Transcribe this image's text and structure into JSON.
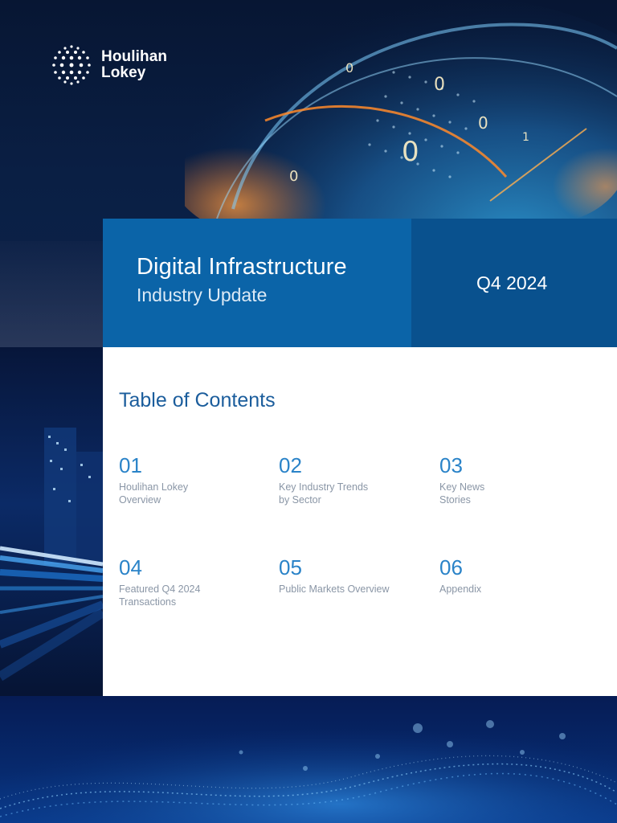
{
  "brand": {
    "name_line1": "Houlihan",
    "name_line2": "Lokey"
  },
  "report": {
    "title": "Digital Infrastructure",
    "subtitle": "Industry Update",
    "period": "Q4 2024"
  },
  "toc": {
    "heading": "Table of Contents",
    "items": [
      {
        "number": "01",
        "label": "Houlihan Lokey\nOverview"
      },
      {
        "number": "02",
        "label": "Key Industry Trends\nby Sector"
      },
      {
        "number": "03",
        "label": "Key News\nStories"
      },
      {
        "number": "04",
        "label": "Featured Q4 2024\nTransactions"
      },
      {
        "number": "05",
        "label": "Public Markets Overview"
      },
      {
        "number": "06",
        "label": "Appendix"
      }
    ]
  },
  "colors": {
    "title_band": "#0b64a8",
    "period_band": "#09518e",
    "toc_heading": "#1b5d9c",
    "toc_number": "#2a83c8",
    "toc_label": "#8a96a6",
    "page_dark": "#081a3a"
  }
}
